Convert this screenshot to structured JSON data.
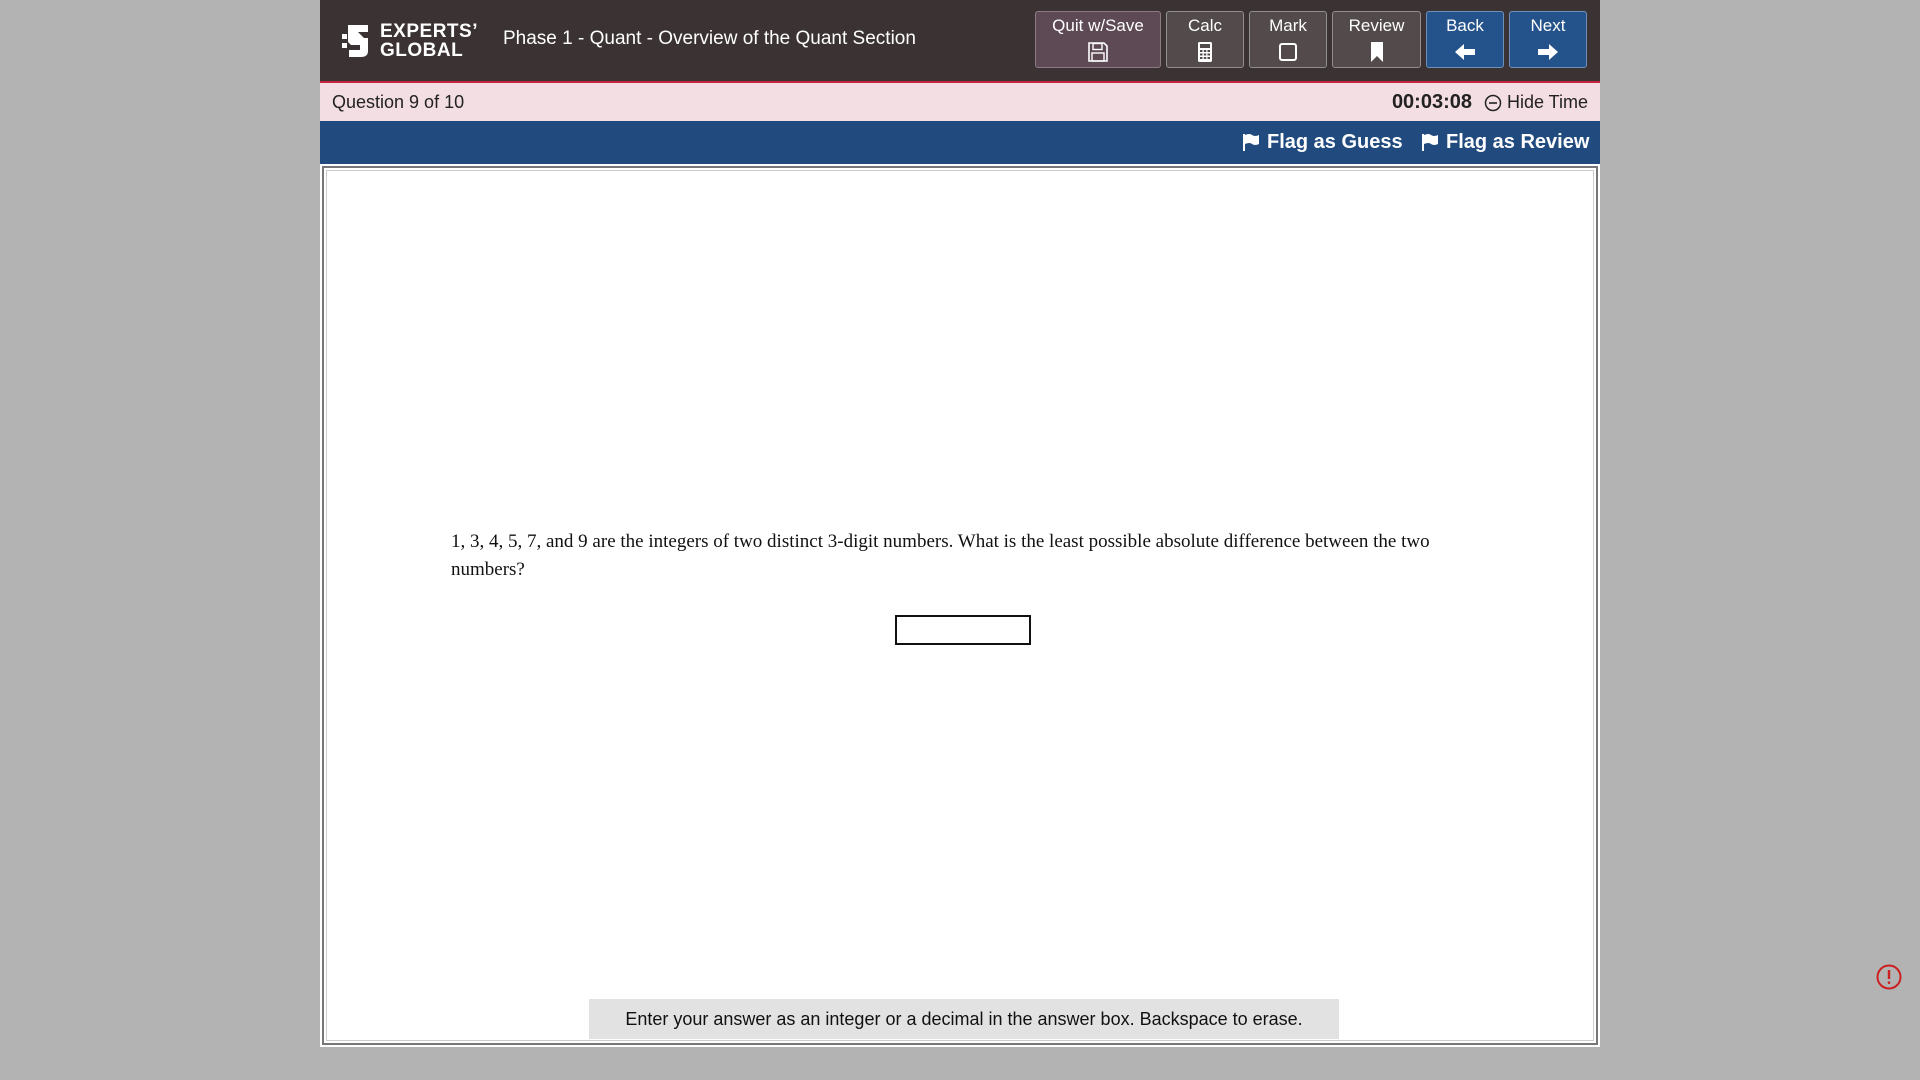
{
  "header": {
    "logo_line1": "EXPERTS’",
    "logo_line2": "GLOBAL",
    "section_title": "Phase 1 - Quant - Overview of the Quant Section",
    "buttons": {
      "quit": "Quit w/Save",
      "calc": "Calc",
      "mark": "Mark",
      "review": "Review",
      "back": "Back",
      "next": "Next"
    }
  },
  "infobar": {
    "question_count": "Question 9 of 10",
    "timer": "00:03:08",
    "hide_time": "Hide Time"
  },
  "flagbar": {
    "flag_guess": "Flag as Guess",
    "flag_review": "Flag as Review"
  },
  "question": {
    "text": "1, 3, 4, 5, 7, and 9 are the integers of two distinct 3-digit numbers. What is the least possible absolute difference between the two numbers?",
    "answer_value": "",
    "instruction": "Enter your answer as an integer or a decimal in the answer box. Backspace to erase."
  },
  "colors": {
    "header_bg": "#3a3233",
    "accent_red": "#c2243f",
    "info_bg": "#f3dee3",
    "flagbar_bg": "#214b7f",
    "nav_blue": "#24528a",
    "page_bg": "#b3b3b3",
    "alert_red": "#cc1f1f"
  },
  "icons": {
    "quit": "save-icon",
    "calc": "calculator-icon",
    "mark": "checkbox-icon",
    "review": "bookmark-icon",
    "back": "arrow-left-icon",
    "next": "arrow-right-icon",
    "hide_time": "minus-circle-icon",
    "flag": "flag-icon",
    "alert": "alert-icon"
  }
}
